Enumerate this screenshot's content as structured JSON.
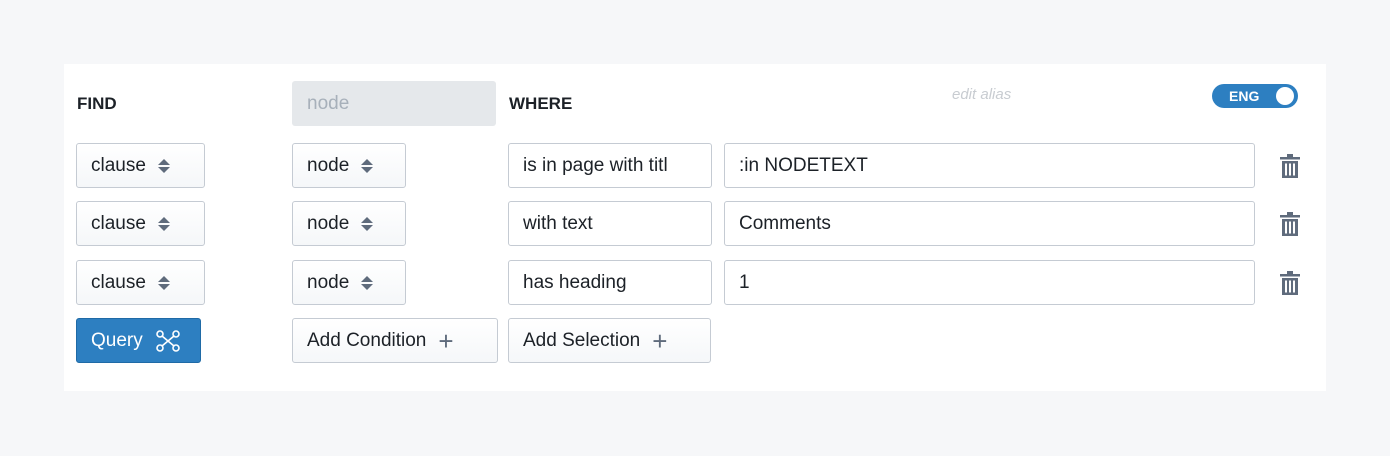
{
  "header": {
    "find_label": "FIND",
    "alias_placeholder": "node",
    "where_label": "WHERE",
    "edit_alias": "edit alias",
    "toggle_label": "ENG",
    "toggle_on": true
  },
  "rows": [
    {
      "clause": "clause",
      "node": "node",
      "condition": "is in page with titl",
      "value": ":in NODETEXT"
    },
    {
      "clause": "clause",
      "node": "node",
      "condition": "with text",
      "value": "Comments"
    },
    {
      "clause": "clause",
      "node": "node",
      "condition": "has heading",
      "value": "1"
    }
  ],
  "actions": {
    "query": "Query",
    "add_condition": "Add Condition",
    "add_selection": "Add Selection"
  },
  "colors": {
    "primary": "#2d7fc1",
    "background": "#f6f7f9"
  }
}
